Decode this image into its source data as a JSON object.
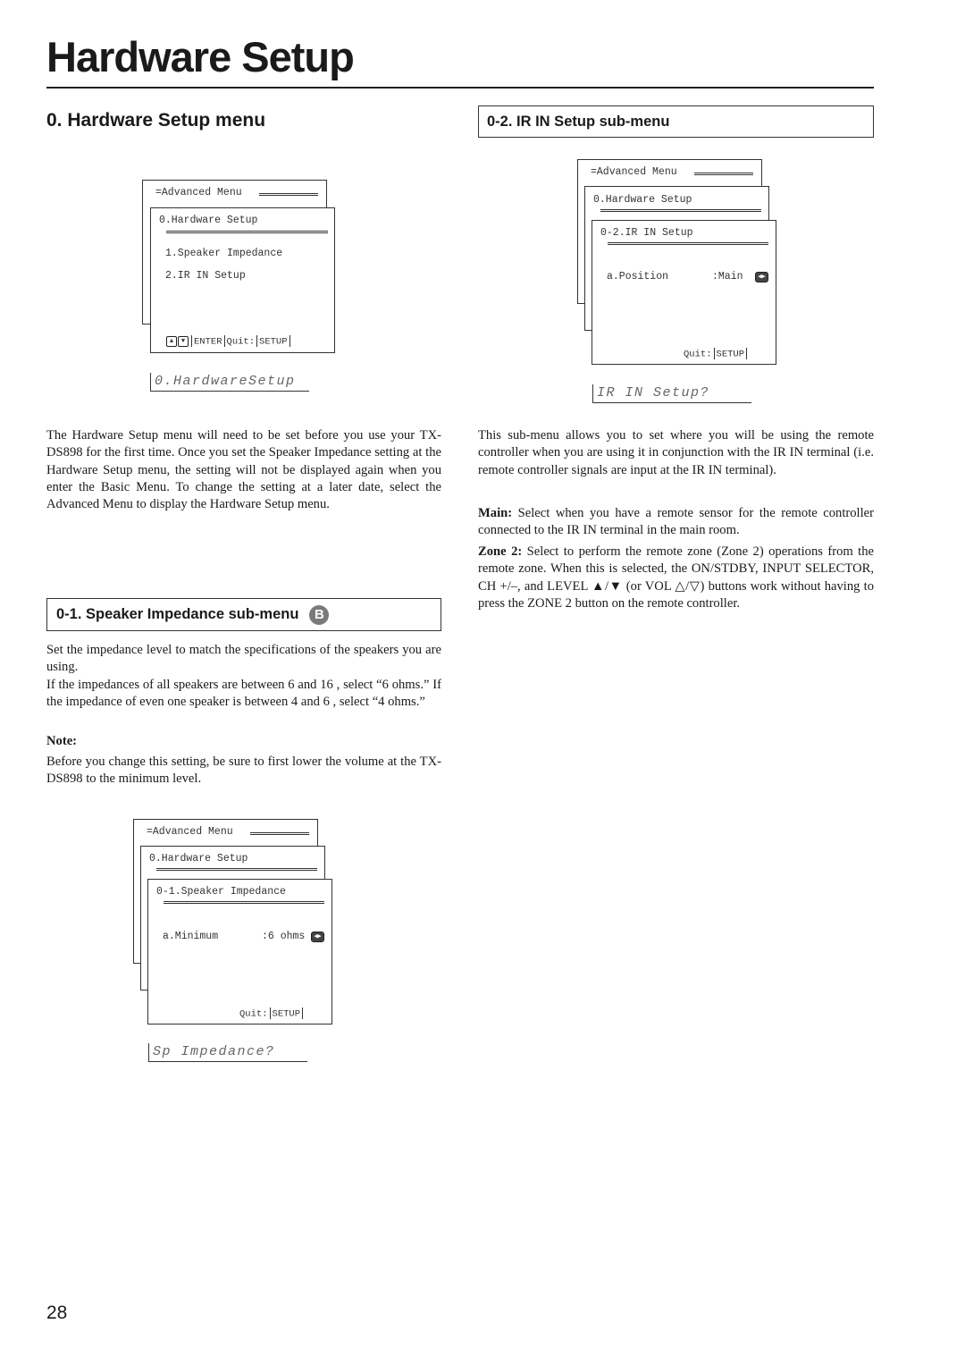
{
  "page": {
    "title": "Hardware Setup",
    "page_number": "28"
  },
  "left": {
    "section_heading": "0. Hardware Setup menu",
    "osd_main": {
      "back_title": "=Advanced Menu",
      "front_title": "0.Hardware Setup",
      "items": [
        "1.Speaker Impedance",
        "2.IR IN Setup"
      ],
      "footer": {
        "up_key": "▲",
        "down_key": "▼",
        "enter": "ENTER",
        "quit": "Quit:",
        "setup": "SETUP"
      }
    },
    "lcd_main": "0.HardwareSetup",
    "intro_text": "The Hardware Setup menu will need to be set before you use your TX-DS898 for the first time. Once you set the Speaker Impedance setting at the Hardware Setup menu, the setting will not be displayed again when you enter the Basic Menu. To change the setting at a later date, select the Advanced Menu to display the Hardware Setup menu.",
    "speaker_heading": "0-1.  Speaker Impedance sub-menu",
    "speaker_badge": "B",
    "speaker_text_1": "Set the impedance level to match the specifications of the speakers you are using.",
    "speaker_text_2": "If the impedances of all speakers are between 6 and 16    , select “6 ohms.” If the impedance of even one speaker is between 4 and 6    , select “4 ohms.”",
    "note_label": "Note:",
    "note_text": "Before you change this setting, be sure to first lower the volume at the TX-DS898 to the minimum level.",
    "osd_speaker": {
      "back_title": "=Advanced Menu",
      "mid_title": "0.Hardware Setup",
      "front_title": "0-1.Speaker Impedance",
      "row_label": "a.Minimum",
      "row_value": ":6 ohms",
      "row_icon": "◀▶",
      "quit": "Quit:",
      "setup": "SETUP"
    },
    "lcd_speaker": "Sp Impedance?"
  },
  "right": {
    "ir_heading": "0-2. IR IN Setup sub-menu",
    "osd_ir": {
      "back_title": "=Advanced Menu",
      "mid_title": "0.Hardware Setup",
      "front_title": "0-2.IR IN Setup",
      "row_label": "a.Position",
      "row_value": ":Main",
      "row_icon": "◀▶",
      "quit": "Quit:",
      "setup": "SETUP"
    },
    "lcd_ir": "IR IN Setup?",
    "ir_text": "This sub-menu allows you to set where you will be using the remote controller when you are using it in conjunction with the IR IN terminal (i.e. remote controller signals are input at the IR IN terminal).",
    "main_label": "Main:",
    "main_text": " Select when you have a remote sensor for the remote controller connected to the IR IN terminal in the main room.",
    "zone_label": "Zone 2:",
    "zone_text": " Select to perform the remote zone (Zone 2) operations from the remote zone. When this is selected, the ON/STDBY, INPUT SELECTOR, CH +/–, and LEVEL ▲/▼ (or VOL △/▽) buttons work without having to press the ZONE 2 button on the remote controller."
  }
}
